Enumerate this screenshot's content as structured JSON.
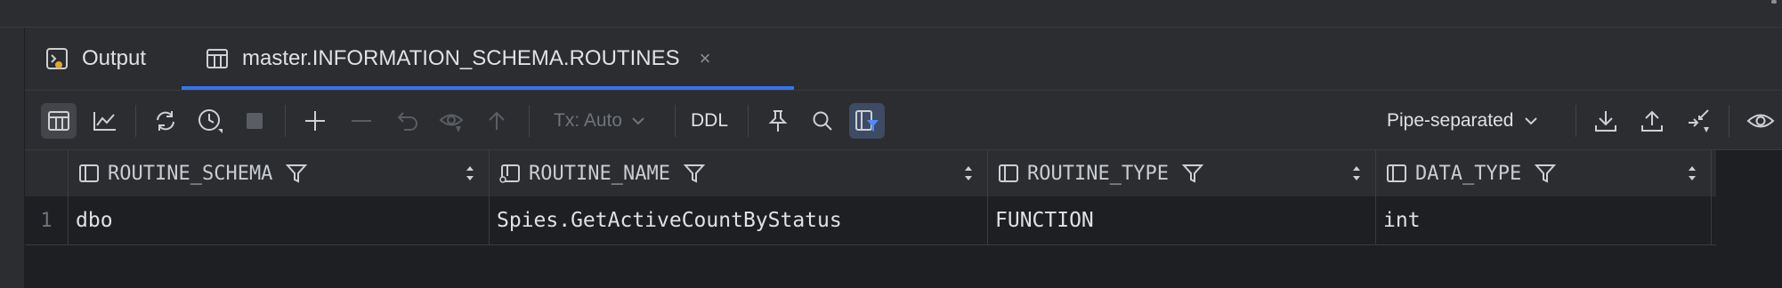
{
  "tabs": [
    {
      "label": "Output",
      "icon": "console-output-icon"
    },
    {
      "label": "master.INFORMATION_SCHEMA.ROUTINES",
      "icon": "table-icon",
      "close": "×"
    }
  ],
  "toolbar": {
    "tx_label": "Tx: Auto",
    "ddl_label": "DDL",
    "format_label": "Pipe-separated"
  },
  "grid": {
    "columns": [
      {
        "name": "ROUTINE_SCHEMA"
      },
      {
        "name": "ROUTINE_NAME"
      },
      {
        "name": "ROUTINE_TYPE"
      },
      {
        "name": "DATA_TYPE"
      }
    ],
    "rows": [
      {
        "num": "1",
        "cells": [
          "dbo",
          "Spies.GetActiveCountByStatus",
          "FUNCTION",
          "int"
        ]
      }
    ]
  },
  "colors": {
    "accent": "#3574f0",
    "background": "#1e1f22",
    "panel": "#2b2d30"
  }
}
